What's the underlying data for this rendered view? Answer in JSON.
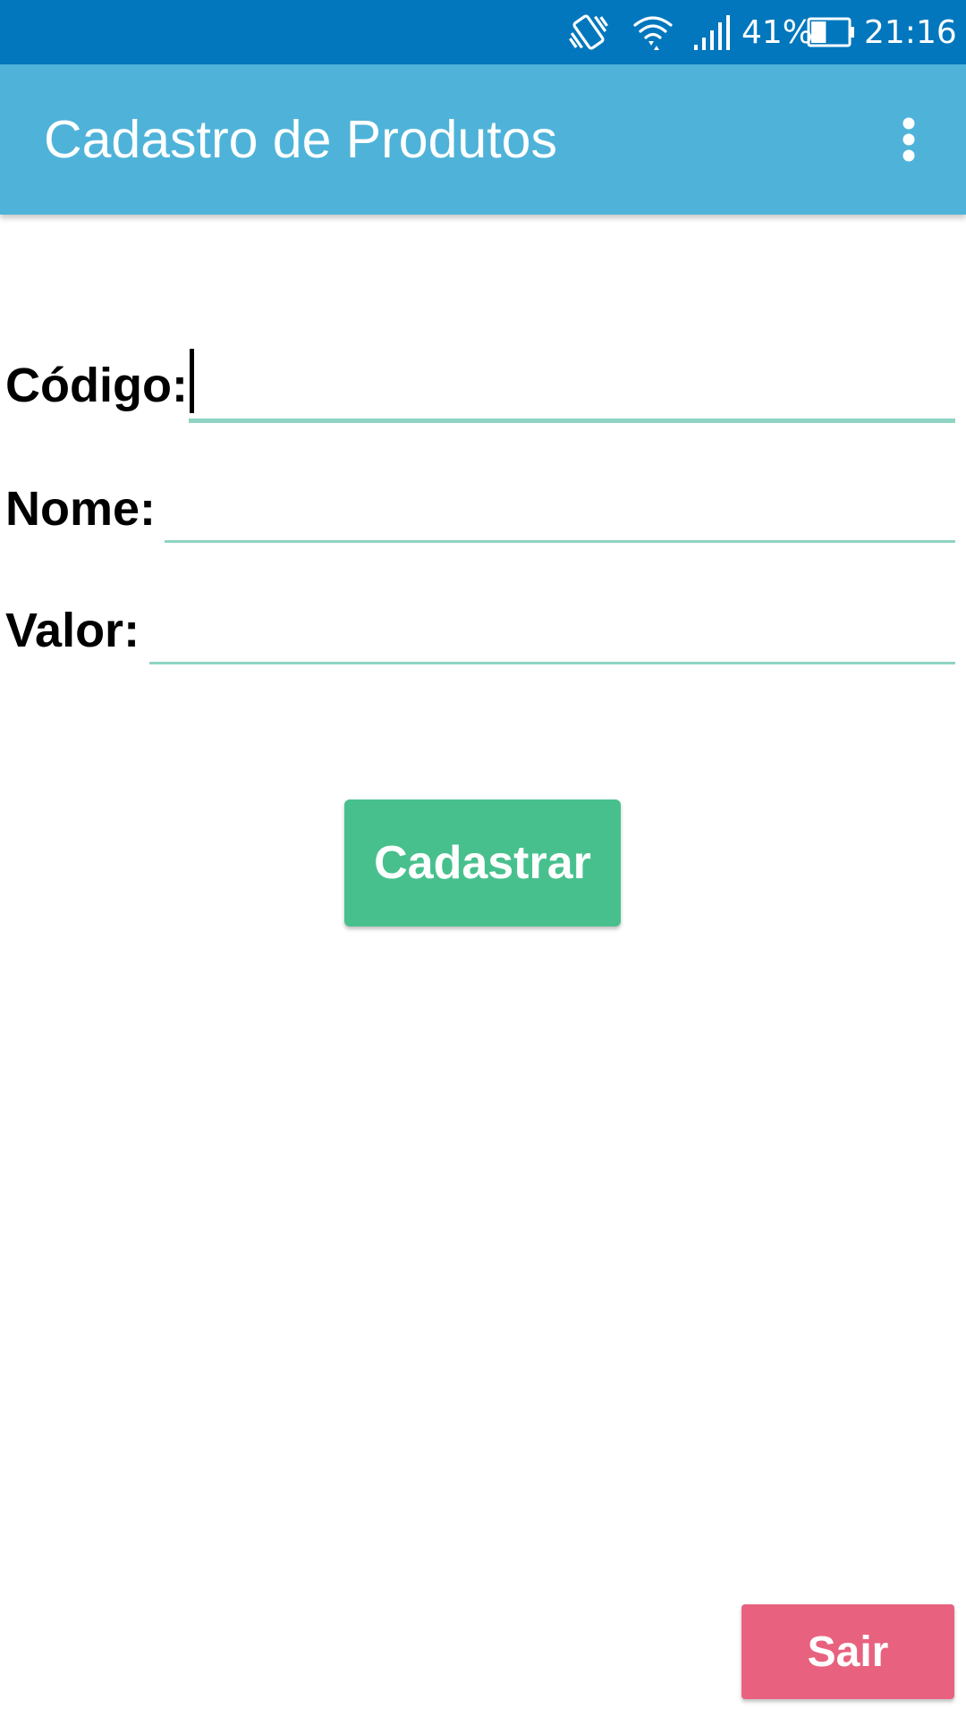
{
  "status_bar": {
    "icons": [
      "vibrate-icon",
      "wifi-icon",
      "signal-icon",
      "battery-icon"
    ],
    "battery_percent": "41%",
    "battery_level": 0.41,
    "time": "21:16"
  },
  "app_bar": {
    "title": "Cadastro de Produtos",
    "menu_icon": "more-vert-icon"
  },
  "form": {
    "codigo_label": "Código:",
    "codigo_value": "",
    "nome_label": "Nome:",
    "nome_value": "",
    "valor_label": "Valor:",
    "valor_value": ""
  },
  "actions": {
    "cadastrar_label": "Cadastrar",
    "sair_label": "Sair"
  },
  "colors": {
    "status_bar": "#0277bd",
    "app_bar": "#4fb3d9",
    "input_underline": "#8fd3c3",
    "cadastrar_button": "#48c08e",
    "sair_button": "#e8627f"
  }
}
